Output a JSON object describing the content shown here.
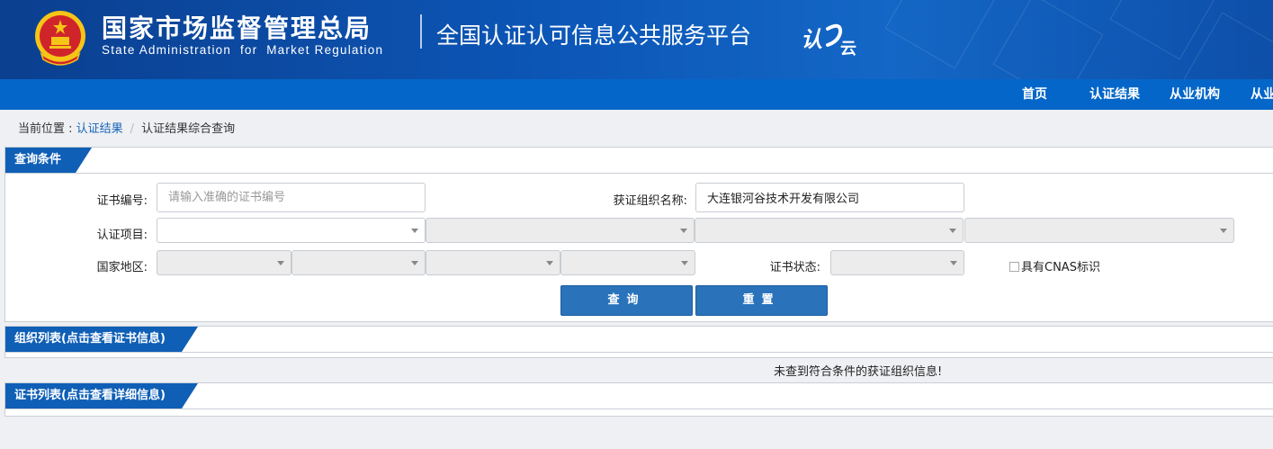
{
  "header": {
    "title_cn": "国家市场监督管理总局",
    "title_en": "State Administration  for  Market Regulation",
    "platform": "全国认证认可信息公共服务平台",
    "logo_text": "认云"
  },
  "nav": {
    "items": [
      {
        "label": "首页"
      },
      {
        "label": "认证结果"
      },
      {
        "label": "从业机构"
      },
      {
        "label": "从业"
      }
    ]
  },
  "breadcrumb": {
    "prefix": "当前位置 : ",
    "link": "认证结果",
    "separator": "/",
    "current": "认证结果综合查询"
  },
  "query": {
    "panel_title": "查询条件",
    "cert_no_label": "证书编号:",
    "cert_no_placeholder": "请输入准确的证书编号",
    "cert_no_value": "",
    "org_name_label": "获证组织名称:",
    "org_name_value": "大连银河谷技术开发有限公司",
    "project_label": "认证项目:",
    "region_label": "国家地区:",
    "status_label": "证书状态:",
    "cnas_label": "具有CNAS标识",
    "search_button": "查询",
    "reset_button": "重置"
  },
  "org_list": {
    "panel_title": "组织列表(点击查看证书信息)",
    "empty_message": "未查到符合条件的获证组织信息!"
  },
  "cert_list": {
    "panel_title": "证书列表(点击查看详细信息)"
  },
  "colors": {
    "header_bg": "#0c57b8",
    "nav_bg": "#0466c8",
    "tab_bg": "#0f5fb6",
    "button_bg": "#2a73bb",
    "link": "#1a64b8"
  }
}
